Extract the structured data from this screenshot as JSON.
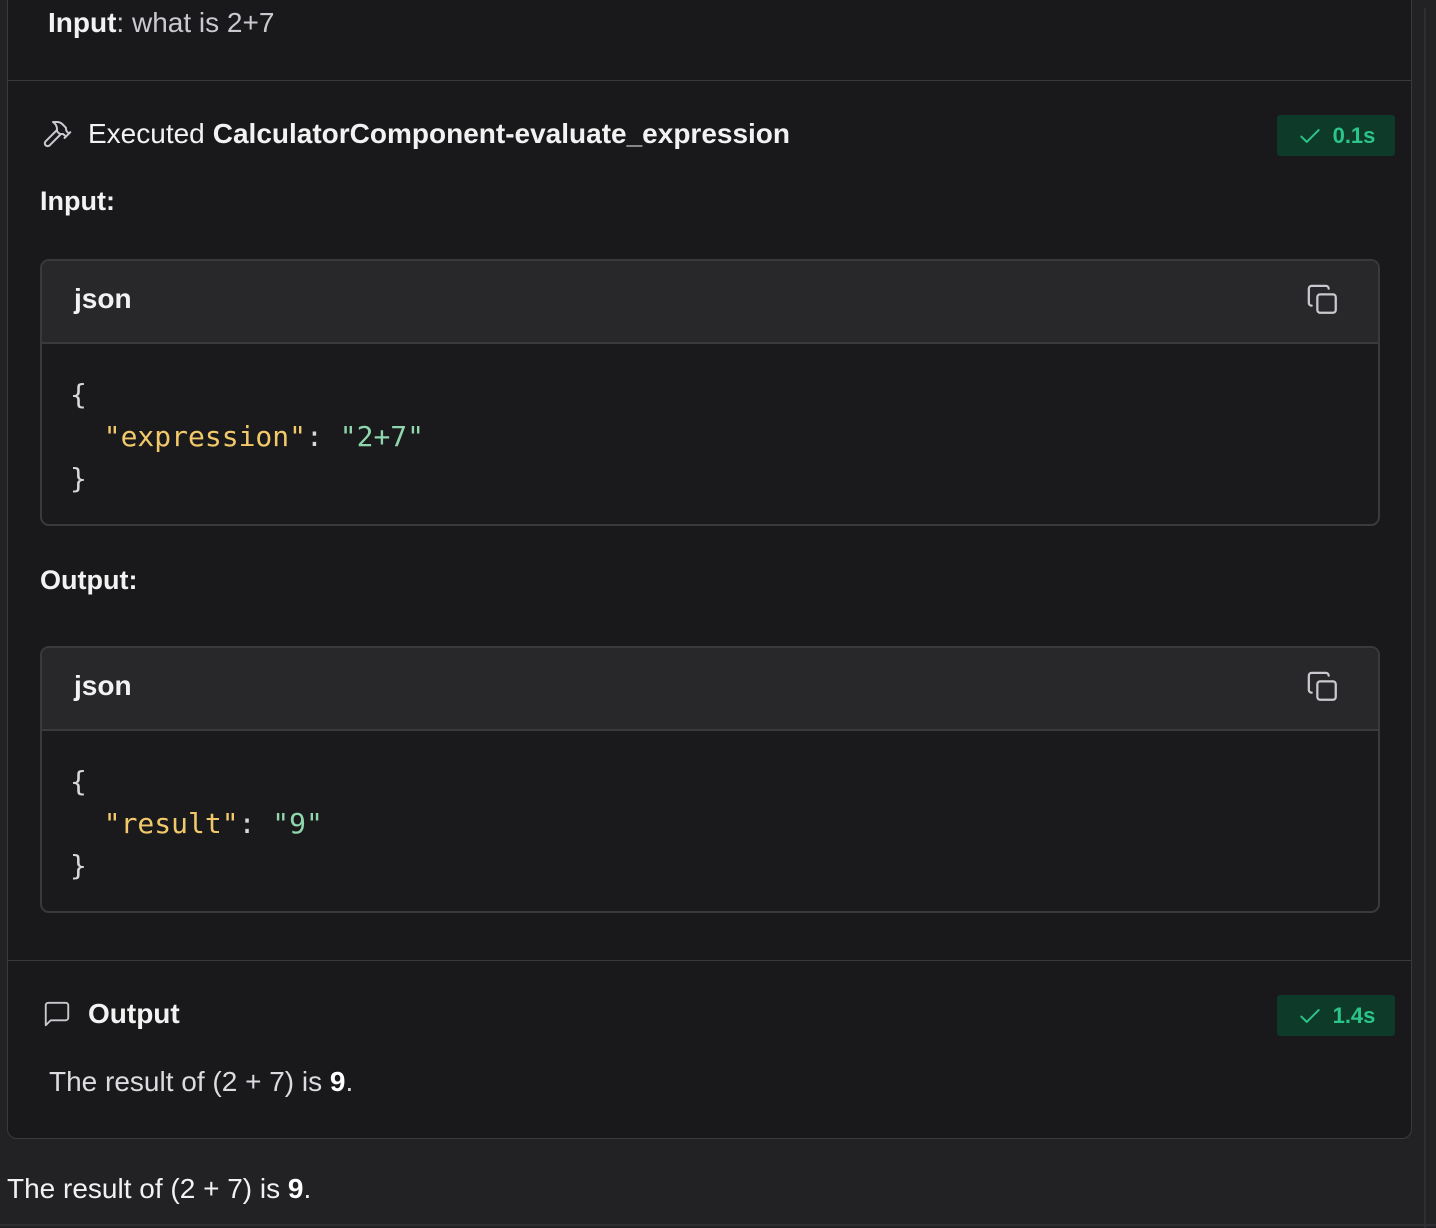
{
  "top_input": {
    "label": "Input",
    "separator": ":",
    "value": "what is 2+7"
  },
  "tool_step": {
    "prefix": "Executed",
    "tool_name": "CalculatorComponent-evaluate_expression",
    "duration": "0.1s",
    "input_label": "Input:",
    "output_label": "Output:",
    "input_code": {
      "lang": "json",
      "open": "{",
      "key": "\"expression\"",
      "colon": ":",
      "value": "\"2+7\"",
      "close": "}"
    },
    "output_code": {
      "lang": "json",
      "open": "{",
      "key": "\"result\"",
      "colon": ":",
      "value": "\"9\"",
      "close": "}"
    }
  },
  "output_step": {
    "title": "Output",
    "duration": "1.4s",
    "text_prefix": "The result of (2 + 7) is ",
    "text_bold": "9",
    "text_suffix": "."
  },
  "final_message": {
    "text_prefix": "The result of (2 + 7) is ",
    "text_bold": "9",
    "text_suffix": "."
  },
  "colors": {
    "background": "#19191b",
    "badge_bg": "#0e3a2a",
    "badge_fg": "#2bc48a",
    "json_key": "#f2c96a",
    "json_string": "#8fd6ad"
  },
  "icons": {
    "tool": "hammer-icon",
    "check": "check-icon",
    "copy": "copy-icon",
    "message": "message-square-icon"
  }
}
